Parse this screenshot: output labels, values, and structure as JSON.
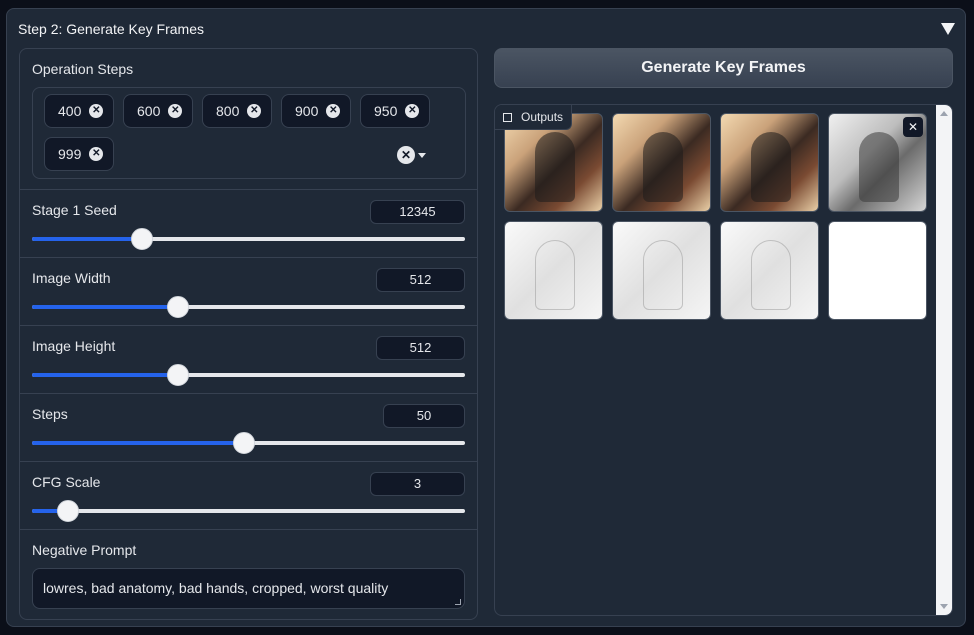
{
  "accordion": {
    "title": "Step 2: Generate Key Frames"
  },
  "operation_steps": {
    "label": "Operation Steps",
    "chips": [
      "400",
      "600",
      "800",
      "900",
      "950",
      "999"
    ]
  },
  "seed": {
    "label": "Stage 1 Seed",
    "value": "12345",
    "fraction": 0.255
  },
  "width": {
    "label": "Image Width",
    "value": "512",
    "fraction": 0.338
  },
  "height": {
    "label": "Image Height",
    "value": "512",
    "fraction": 0.338
  },
  "steps": {
    "label": "Steps",
    "value": "50",
    "fraction": 0.49
  },
  "cfg": {
    "label": "CFG Scale",
    "value": "3",
    "fraction": 0.083
  },
  "negative": {
    "label": "Negative Prompt",
    "value": "lowres, bad anatomy, bad hands, cropped, worst quality"
  },
  "generate": {
    "label": "Generate Key Frames"
  },
  "gallery": {
    "label": "Outputs",
    "images": [
      "color-frame",
      "color-frame",
      "color-frame",
      "gray-frame",
      "sketch-frame",
      "sketch-frame",
      "sketch-frame",
      "blank-frame"
    ]
  },
  "icons": {
    "close": "close-icon",
    "caret": "chevron-down-icon",
    "image": "image-icon"
  }
}
